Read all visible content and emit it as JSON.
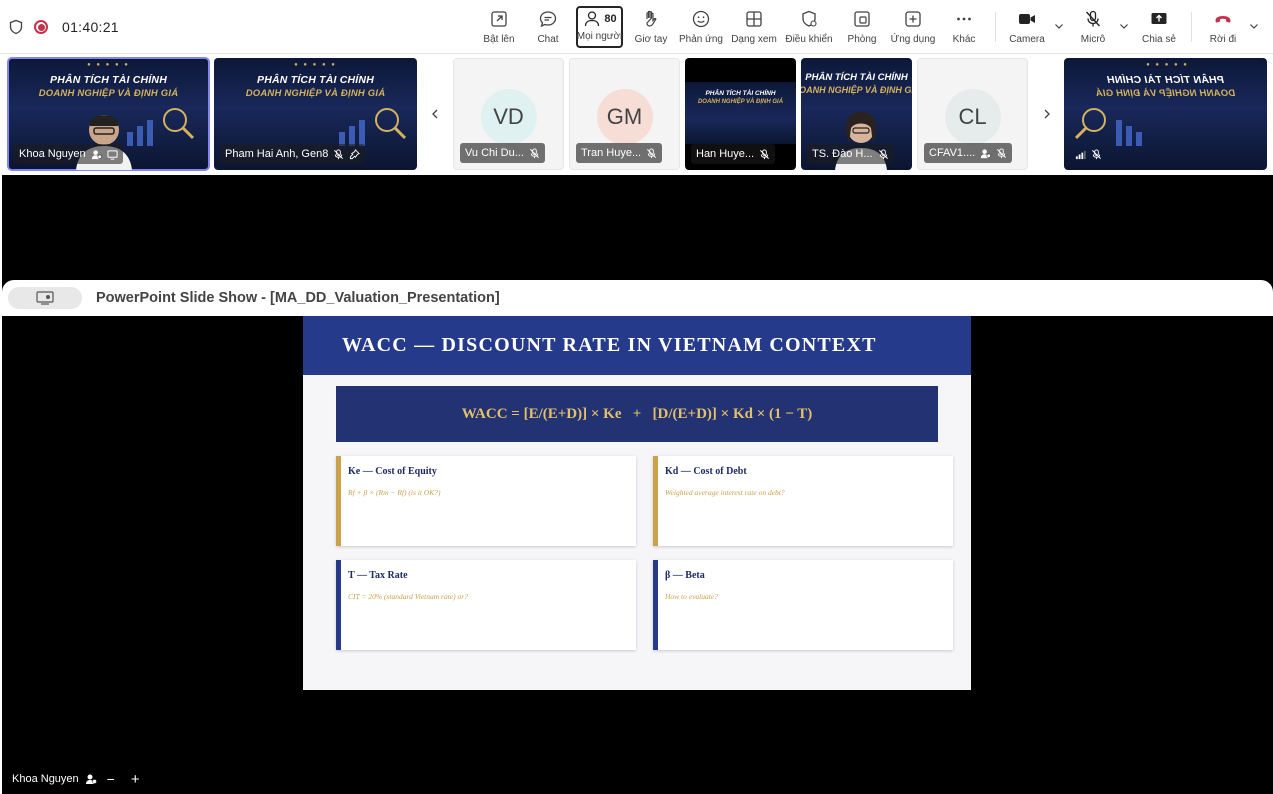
{
  "call": {
    "timer": "01:40:21"
  },
  "toolbar": {
    "raise_label": "Bật lên",
    "chat_label": "Chat",
    "people_label": "Mọi người",
    "people_count": "80",
    "hand_label": "Giơ tay",
    "react_label": "Phản ứng",
    "view_label": "Dạng xem",
    "control_label": "Điều khiển",
    "rooms_label": "Phòng",
    "apps_label": "Ứng dụng",
    "more_label": "Khác",
    "camera_label": "Camera",
    "mic_label": "Micrô",
    "share_label": "Chia sẻ",
    "leave_label": "Rời đi"
  },
  "banner": {
    "line1": "PHÂN TÍCH TÀI CHÍNH",
    "line2": "DOANH NGHIỆP VÀ ĐỊNH GIÁ"
  },
  "participants": [
    {
      "name": "Khoa Nguyen"
    },
    {
      "name": "Pham Hai Anh, Gen8"
    },
    {
      "initials": "VD",
      "name": "Vu Chi Du...",
      "color": "#dff1f1"
    },
    {
      "initials": "GM",
      "name": "Tran Huye...",
      "color": "#f6ddd6"
    },
    {
      "name": "Han Huye..."
    },
    {
      "name": "TS. Đào H..."
    },
    {
      "initials": "CL",
      "name": "CFAV1....",
      "color": "#e6ecec"
    },
    {
      "name": ""
    }
  ],
  "share": {
    "title": "PowerPoint Slide Show - [MA_DD_Valuation_Presentation]"
  },
  "slide": {
    "title": "WACC — DISCOUNT RATE IN VIETNAM CONTEXT",
    "formula": "WACC = [E/(E+D)] × Ke   +   [D/(E+D)] × Kd × (1 − T)",
    "cards": [
      {
        "title": "Ke — Cost of Equity",
        "subtitle": "Rf + β × (Rm − Rf) (is it OK?)",
        "accent": "#c9a24a"
      },
      {
        "title": "Kd — Cost of Debt",
        "subtitle": "Weighted average interest rate on debt?",
        "accent": "#c9a24a"
      },
      {
        "title": "T — Tax Rate",
        "subtitle": "CIT = 20% (standard Vietnam rate) or?",
        "accent": "#253a8a"
      },
      {
        "title": "β — Beta",
        "subtitle": "How to evaluate?",
        "accent": "#253a8a"
      }
    ]
  },
  "presenter": {
    "name": "Khoa Nguyen",
    "zoom_out": "−",
    "zoom_in": "+"
  },
  "colors": {
    "slide_header": "#253a8a",
    "formula_bg": "#223272",
    "gold": "#c9a24a",
    "leave_red": "#c4314b",
    "selected_outline": "#7f85f5"
  }
}
